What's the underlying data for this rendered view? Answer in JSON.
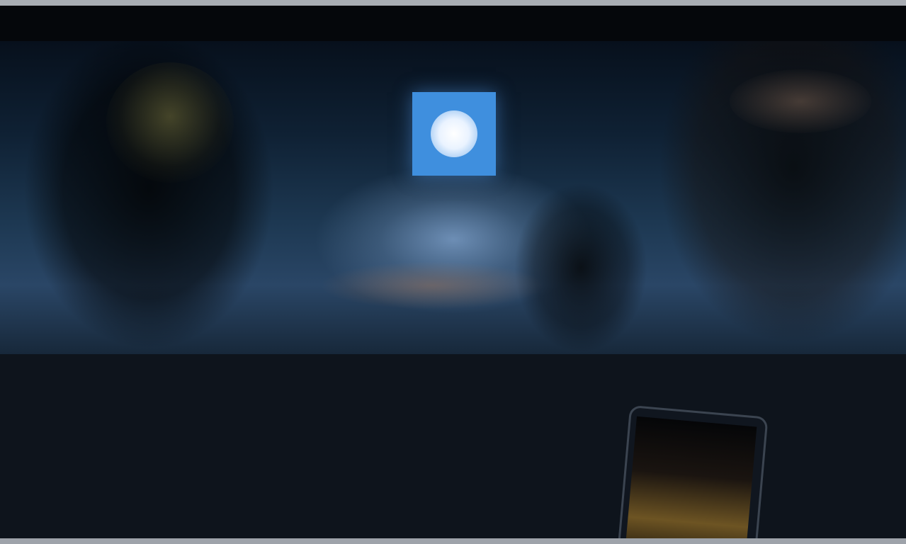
{
  "header": {
    "brand": "",
    "nav": [
      {
        "label": ""
      },
      {
        "label": ""
      },
      {
        "label": ""
      }
    ]
  },
  "hero": {
    "logo_icon": "app-logo-icon",
    "tagline": ""
  },
  "feature": {
    "title": "",
    "body": ""
  },
  "colors": {
    "accent": "#3f8fde",
    "background": "#0e141c",
    "header": "#05070b"
  }
}
